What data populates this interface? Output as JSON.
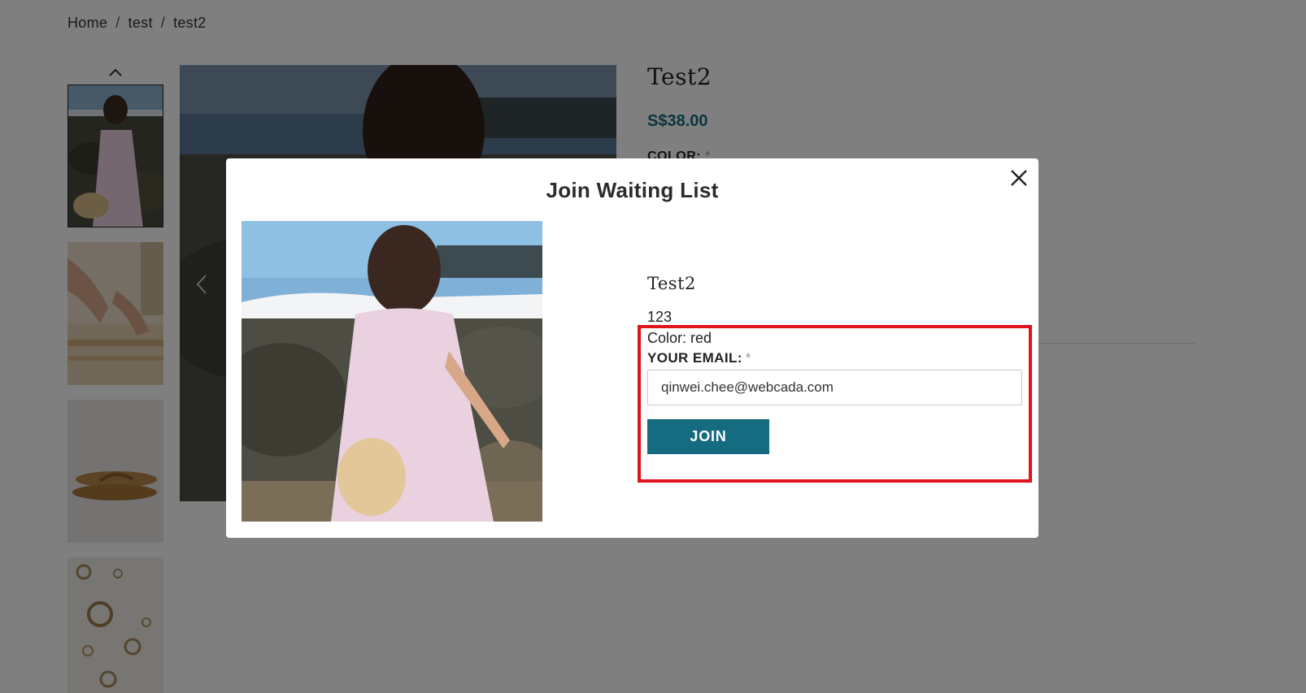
{
  "breadcrumb": {
    "items": [
      "Home",
      "test",
      "test2"
    ],
    "separator": "/"
  },
  "product": {
    "title": "Test2",
    "price": "S$38.00",
    "color_label": "COLOR:",
    "required_mark": "*"
  },
  "thumbnails": {
    "up_icon": "chevron-up-icon",
    "items": [
      "woman-beach-dress",
      "hands-weaving",
      "leather-sandals",
      "gold-earrings"
    ]
  },
  "modal": {
    "title": "Join Waiting List",
    "close_icon": "close-icon",
    "product_name": "Test2",
    "variant_sku": "123",
    "color_text": "Color: red",
    "email_label": "YOUR EMAIL:",
    "email_required_mark": "*",
    "email_value": "qinwei.chee@webcada.com",
    "join_label": "JOIN"
  },
  "colors": {
    "accent": "#156b80",
    "overlay": "rgba(0,0,0,0.5)",
    "highlight": "#e0141e"
  }
}
